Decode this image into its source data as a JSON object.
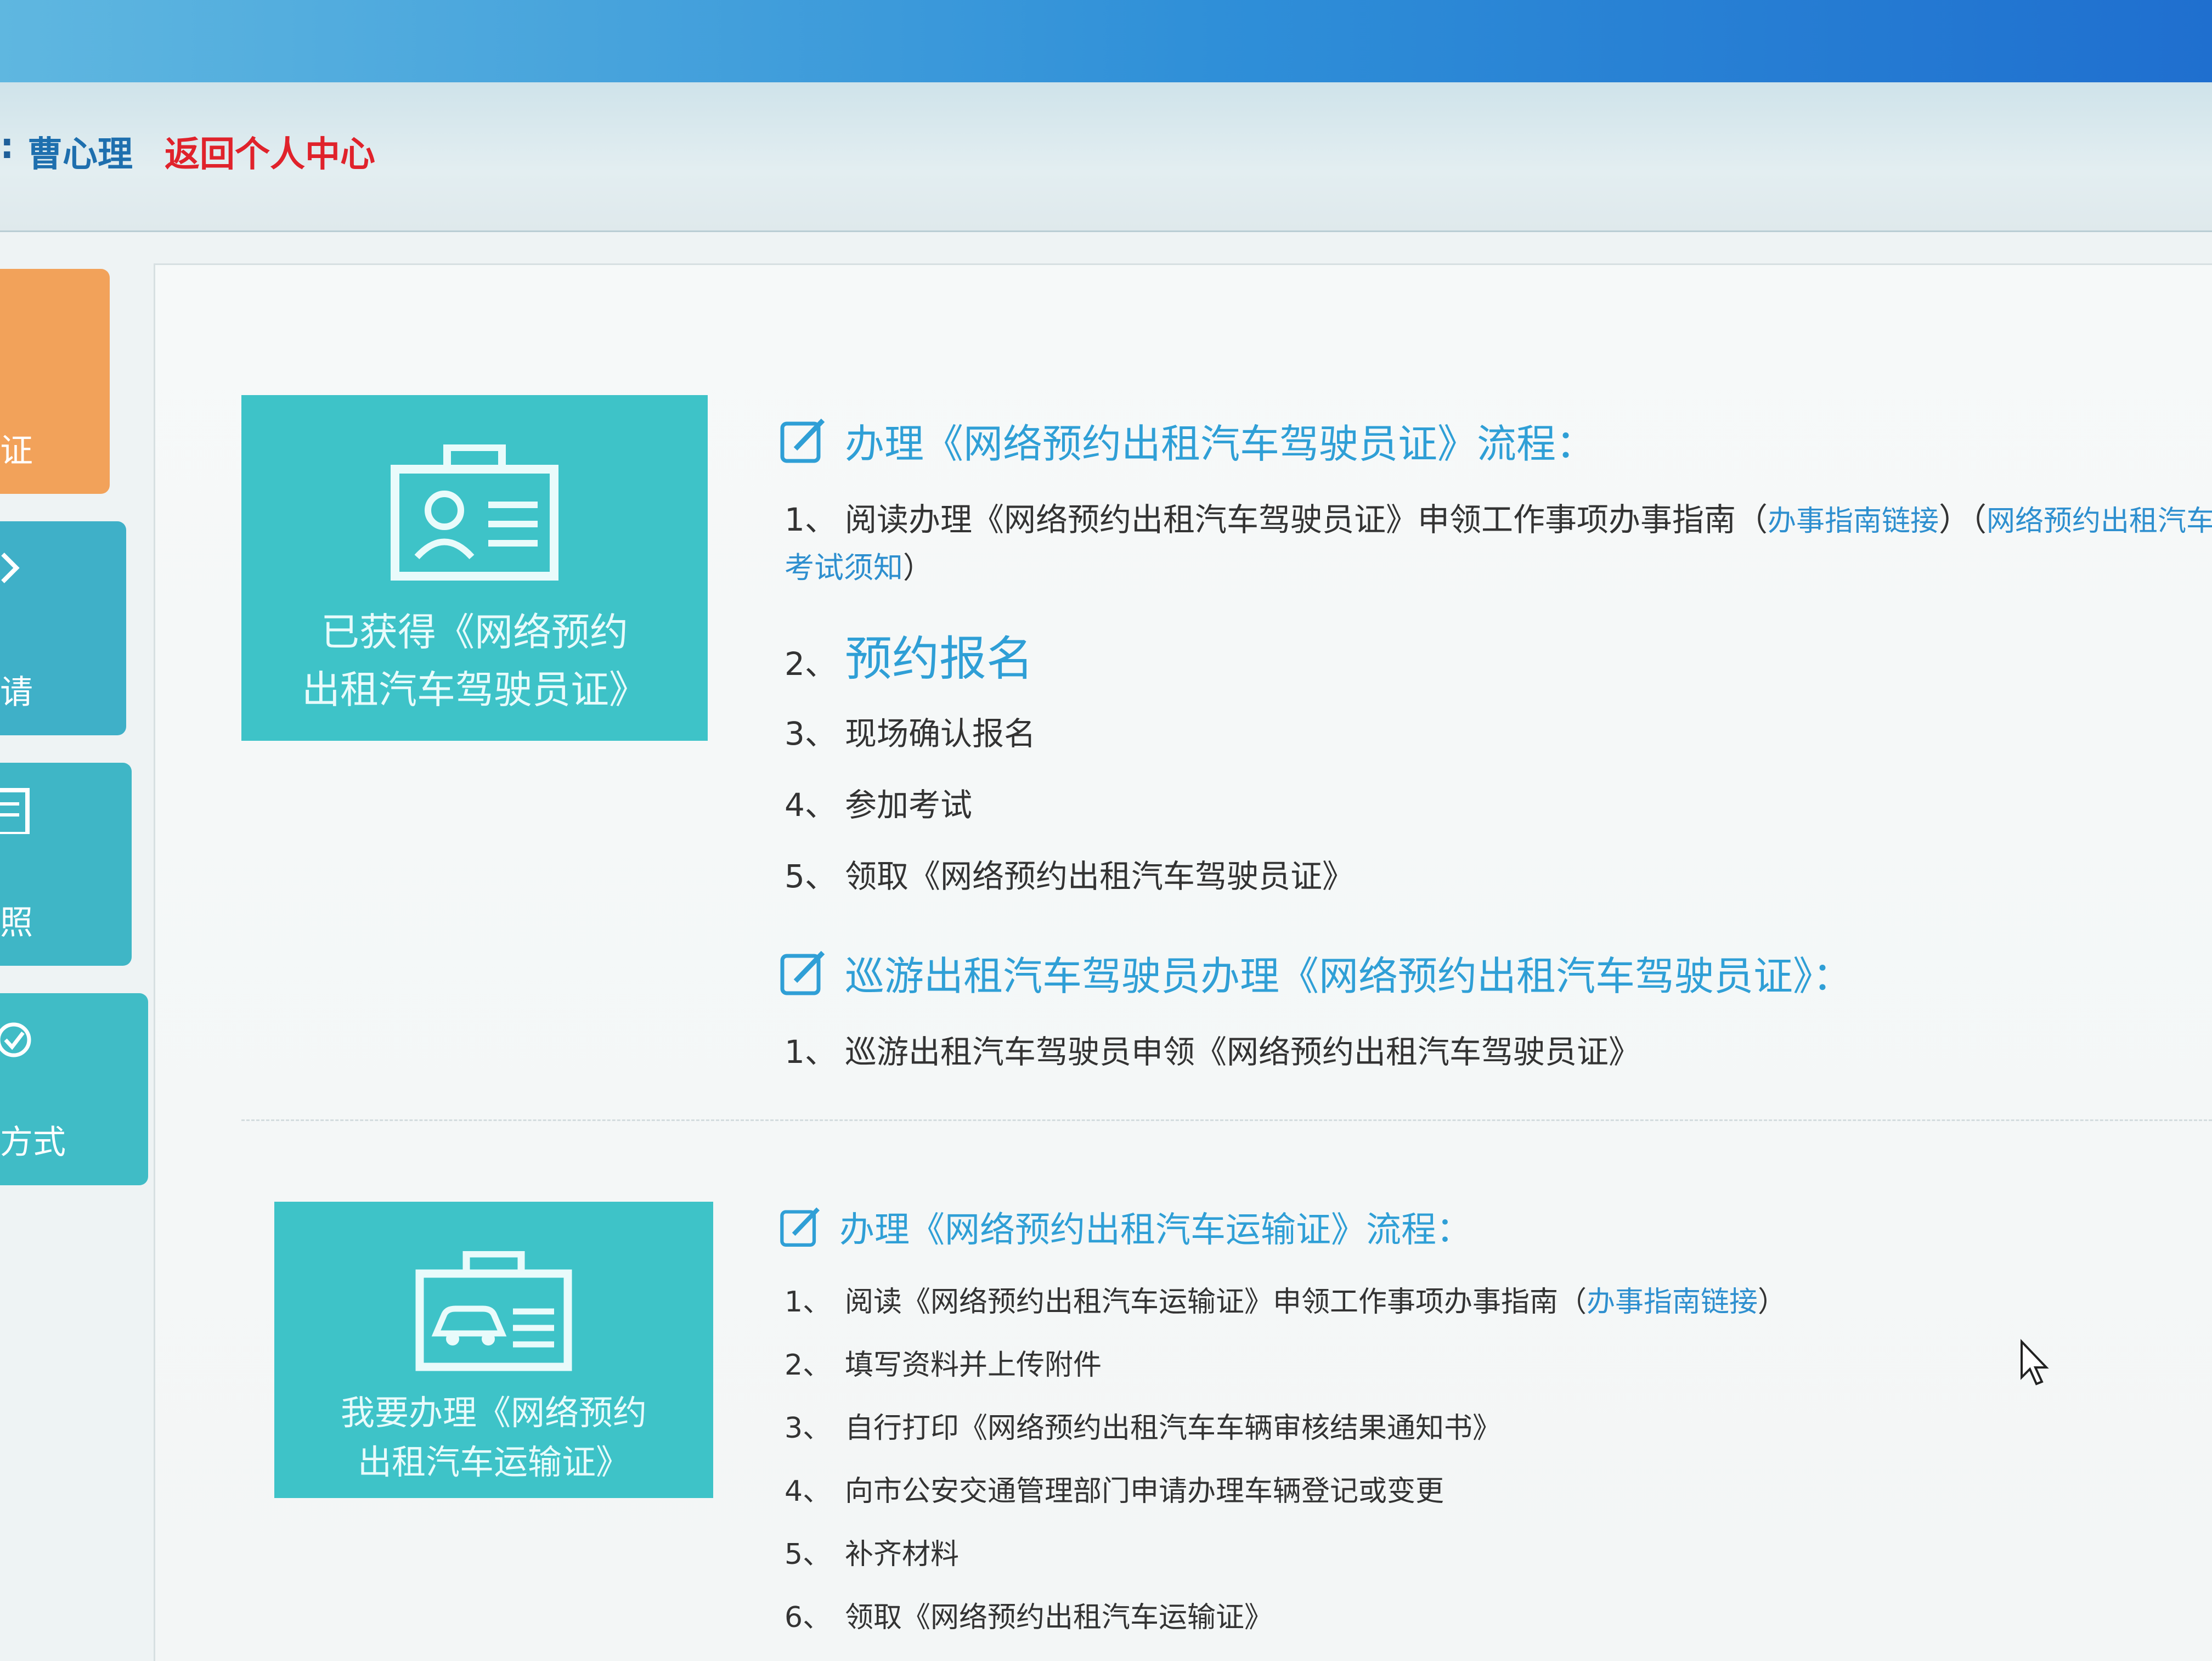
{
  "header": {
    "user_prefix": ":",
    "user_name": "曹心理",
    "back_label": "返回个人中心"
  },
  "sidebar": {
    "tabs": [
      {
        "label": "证"
      },
      {
        "label": "请"
      },
      {
        "label": "照"
      },
      {
        "label": "方式"
      }
    ]
  },
  "cards": [
    {
      "line1": "已获得《网络预约",
      "line2": "出租汽车驾驶员证》",
      "icon": "id-card-icon"
    },
    {
      "line1": "我要办理《网络预约",
      "line2": "出租汽车运输证》",
      "icon": "car-license-icon"
    }
  ],
  "section1": {
    "title": "办理《网络预约出租汽车驾驶员证》流程：",
    "steps": [
      {
        "num": "1、",
        "text": "阅读办理《网络预约出租汽车驾驶员证》申领工作事项办事指南（",
        "link": "办事指南链接",
        "after": "）（",
        "link2": "网络预约出租汽车"
      },
      {
        "num": "2、",
        "text": "预约报名"
      },
      {
        "num": "3、",
        "text": "现场确认报名"
      },
      {
        "num": "4、",
        "text": "参加考试"
      },
      {
        "num": "5、",
        "text": "领取《网络预约出租汽车驾驶员证》"
      }
    ],
    "continuation_link": "考试须知",
    "continuation_after": "）"
  },
  "section2": {
    "title": "巡游出租汽车驾驶员办理《网络预约出租汽车驾驶员证》：",
    "steps": [
      {
        "num": "1、",
        "text": "巡游出租汽车驾驶员申领《网络预约出租汽车驾驶员证》"
      }
    ]
  },
  "section3": {
    "title": "办理《网络预约出租汽车运输证》流程：",
    "steps": [
      {
        "num": "1、",
        "text": "阅读《网络预约出租汽车运输证》申领工作事项办事指南（",
        "link": "办事指南链接",
        "after": "）"
      },
      {
        "num": "2、",
        "text": "填写资料并上传附件"
      },
      {
        "num": "3、",
        "text": "自行打印《网络预约出租汽车车辆审核结果通知书》"
      },
      {
        "num": "4、",
        "text": "向市公安交通管理部门申请办理车辆登记或变更"
      },
      {
        "num": "5、",
        "text": "补齐材料"
      },
      {
        "num": "6、",
        "text": "领取《网络预约出租汽车运输证》"
      }
    ]
  },
  "colors": {
    "accent": "#2f9fd6",
    "card": "#3ec3c8",
    "back_link": "#e0222b",
    "tab_orange": "#f2a25a"
  }
}
